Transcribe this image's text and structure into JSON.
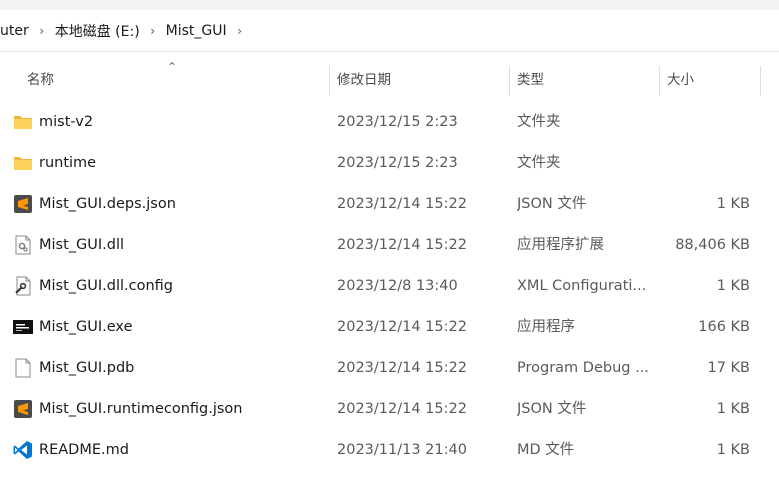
{
  "breadcrumb": {
    "items": [
      {
        "label": "uter"
      },
      {
        "label": "本地磁盘 (E:)"
      },
      {
        "label": "Mist_GUI"
      }
    ]
  },
  "columns": {
    "name": "名称",
    "modified": "修改日期",
    "type": "类型",
    "size": "大小"
  },
  "files": [
    {
      "icon": "folder-icon",
      "name": "mist-v2",
      "modified": "2023/12/15 2:23",
      "type": "文件夹",
      "size": ""
    },
    {
      "icon": "folder-icon",
      "name": "runtime",
      "modified": "2023/12/15 2:23",
      "type": "文件夹",
      "size": ""
    },
    {
      "icon": "sublime-json-icon",
      "name": "Mist_GUI.deps.json",
      "modified": "2023/12/14 15:22",
      "type": "JSON 文件",
      "size": "1 KB"
    },
    {
      "icon": "dll-file-icon",
      "name": "Mist_GUI.dll",
      "modified": "2023/12/14 15:22",
      "type": "应用程序扩展",
      "size": "88,406 KB"
    },
    {
      "icon": "config-file-icon",
      "name": "Mist_GUI.dll.config",
      "modified": "2023/12/8 13:40",
      "type": "XML Configurati...",
      "size": "1 KB"
    },
    {
      "icon": "exe-file-icon",
      "name": "Mist_GUI.exe",
      "modified": "2023/12/14 15:22",
      "type": "应用程序",
      "size": "166 KB"
    },
    {
      "icon": "blank-file-icon",
      "name": "Mist_GUI.pdb",
      "modified": "2023/12/14 15:22",
      "type": "Program Debug ...",
      "size": "17 KB"
    },
    {
      "icon": "sublime-json-icon",
      "name": "Mist_GUI.runtimeconfig.json",
      "modified": "2023/12/14 15:22",
      "type": "JSON 文件",
      "size": "1 KB"
    },
    {
      "icon": "vscode-md-icon",
      "name": "README.md",
      "modified": "2023/11/13 21:40",
      "type": "MD 文件",
      "size": "1 KB"
    }
  ]
}
